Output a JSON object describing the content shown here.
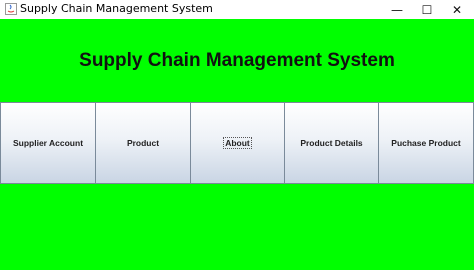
{
  "window": {
    "title": "Supply Chain Management System",
    "minimize_glyph": "—",
    "maximize_glyph": "☐",
    "close_glyph": "✕",
    "app_icon": "java-icon"
  },
  "main": {
    "heading": "Supply Chain Management System",
    "background_color": "#00ff00"
  },
  "menu": {
    "items": [
      {
        "label": "Supplier Account"
      },
      {
        "label": "Product"
      },
      {
        "label": "About",
        "focused": true
      },
      {
        "label": "Product Details"
      },
      {
        "label": "Puchase Product"
      }
    ]
  }
}
